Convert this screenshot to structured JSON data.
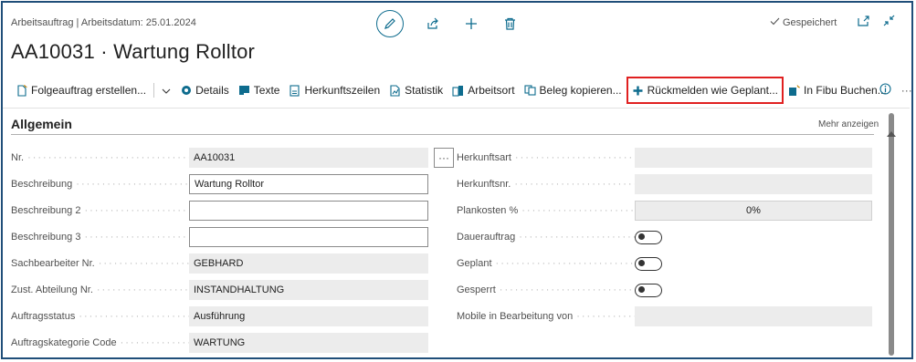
{
  "header": {
    "meta": "Arbeitsauftrag | Arbeitsdatum: 25.01.2024",
    "title": "AA10031 · Wartung Rolltor",
    "saved_label": "Gespeichert"
  },
  "icons": {
    "edit": "pencil-icon",
    "share": "share-icon",
    "add": "plus-icon",
    "delete": "trash-icon",
    "open_new_window": "open-in-new-window-icon",
    "collapse": "collapse-icon",
    "info": "info-icon"
  },
  "toolbar": {
    "items": [
      {
        "label": "Folgeauftrag erstellen...",
        "icon": "new-document-icon"
      },
      {
        "label": "Details",
        "icon": "details-icon"
      },
      {
        "label": "Texte",
        "icon": "text-icon"
      },
      {
        "label": "Herkunftszeilen",
        "icon": "document-lines-icon"
      },
      {
        "label": "Statistik",
        "icon": "statistics-icon"
      },
      {
        "label": "Arbeitsort",
        "icon": "location-icon"
      },
      {
        "label": "Beleg kopieren...",
        "icon": "copy-document-icon"
      },
      {
        "label": "Rückmelden wie Geplant...",
        "icon": "plus-icon"
      },
      {
        "label": "In Fibu Buchen...",
        "icon": "post-icon"
      }
    ],
    "more": "···"
  },
  "section": {
    "title": "Allgemein",
    "show_more": "Mehr anzeigen"
  },
  "fields_left": [
    {
      "label": "Nr.",
      "value": "AA10031"
    },
    {
      "label": "Beschreibung",
      "value": "Wartung Rolltor"
    },
    {
      "label": "Beschreibung 2",
      "value": ""
    },
    {
      "label": "Beschreibung 3",
      "value": ""
    },
    {
      "label": "Sachbearbeiter Nr.",
      "value": "GEBHARD"
    },
    {
      "label": "Zust. Abteilung Nr.",
      "value": "INSTANDHALTUNG"
    },
    {
      "label": "Auftragsstatus",
      "value": "Ausführung"
    },
    {
      "label": "Auftragskategorie Code",
      "value": "WARTUNG"
    }
  ],
  "fields_right": [
    {
      "label": "Herkunftsart",
      "value": ""
    },
    {
      "label": "Herkunftsnr.",
      "value": ""
    },
    {
      "label": "Plankosten %",
      "value": "0%"
    },
    {
      "label": "Dauerauftrag",
      "value": false
    },
    {
      "label": "Geplant",
      "value": false
    },
    {
      "label": "Gesperrt",
      "value": false
    },
    {
      "label": "Mobile in Bearbeitung von",
      "value": ""
    }
  ],
  "assist_label": "···",
  "colors": {
    "accent": "#0e6c8e",
    "highlight": "#e02020",
    "frame": "#1f4e79"
  }
}
